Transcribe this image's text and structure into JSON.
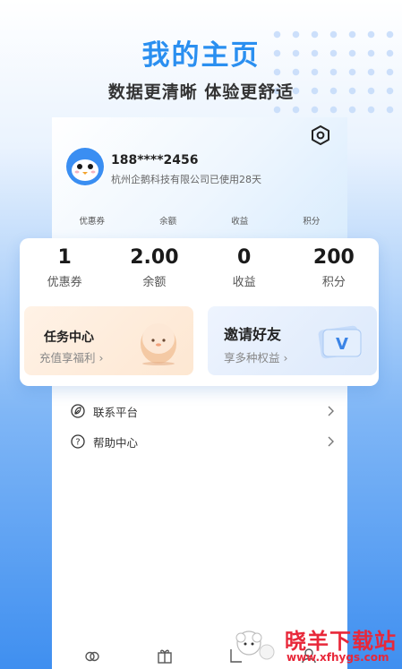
{
  "promo": {
    "title": "我的主页",
    "subtitle": "数据更清晰 体验更舒适"
  },
  "profile": {
    "phone": "188****2456",
    "company": "杭州企鹅科技有限公司已使用28天",
    "settings_icon": "hexagon-gear-icon"
  },
  "mini_stats": [
    "优惠券",
    "余额",
    "收益",
    "积分"
  ],
  "stats": [
    {
      "value": "1",
      "label": "优惠券"
    },
    {
      "value": "2.00",
      "label": "余额"
    },
    {
      "value": "0",
      "label": "收益"
    },
    {
      "value": "200",
      "label": "积分"
    }
  ],
  "actions": {
    "task": {
      "title": "任务中心",
      "subtitle": "充值享福利"
    },
    "invite": {
      "title": "邀请好友",
      "subtitle": "享多种权益"
    }
  },
  "menu": [
    {
      "label": "联系平台",
      "icon": "leaf-icon"
    },
    {
      "label": "帮助中心",
      "icon": "question-circle-icon"
    }
  ],
  "watermark": {
    "name": "晓羊下载站",
    "url": "www.xfhygs.com"
  },
  "colors": {
    "accent": "#2a8ff0",
    "watermark": "#e8283a"
  }
}
